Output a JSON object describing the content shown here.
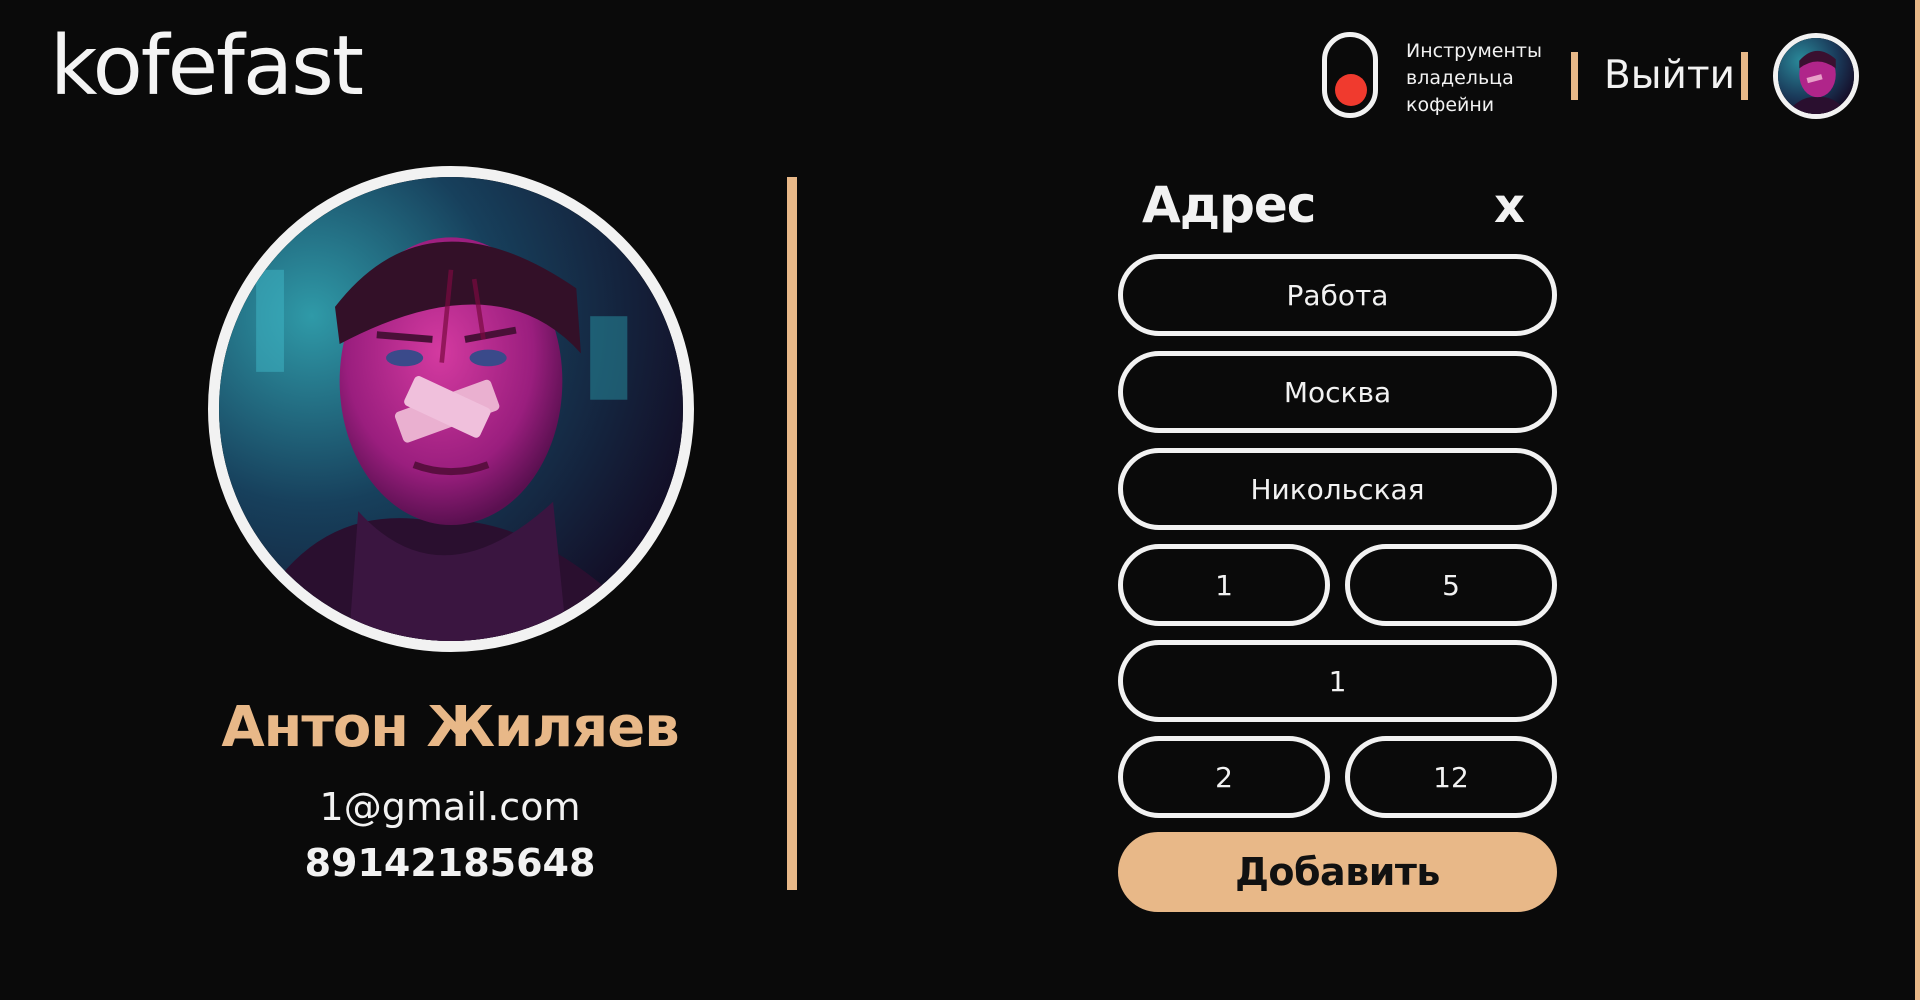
{
  "header": {
    "logo": "kofefast",
    "owner_tools_line1": "Инструменты",
    "owner_tools_line2": "владельца",
    "owner_tools_line3": "кофейни",
    "logout_label": "Выйти",
    "toggle_color": "#f03a2e"
  },
  "profile": {
    "name": "Антон Жиляев",
    "email": "1@gmail.com",
    "phone": "89142185648"
  },
  "address_form": {
    "title": "Адрес",
    "close_label": "x",
    "fields": {
      "label": "Работа",
      "city": "Москва",
      "street": "Никольская",
      "house": "1",
      "building": "5",
      "entrance": "1",
      "floor": "2",
      "apartment": "12"
    },
    "submit_label": "Добавить"
  },
  "colors": {
    "background": "#0a0a0a",
    "accent": "#e8b888",
    "text": "#f2f2f2",
    "toggle_knob": "#f03a2e"
  }
}
